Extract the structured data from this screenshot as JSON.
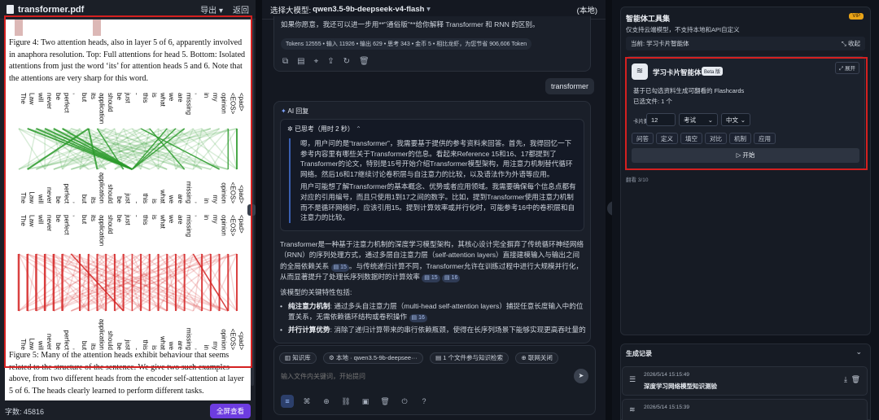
{
  "left": {
    "file_title": "transformer.pdf",
    "export_label": "导出",
    "export_arrow": "▾",
    "back_label": "返回",
    "caption4": "Figure 4: Two attention heads, also in layer 5 of 6, apparently involved in anaphora resolution. Top: Full attentions for head 5. Bottom: Isolated attentions from just the word ‘its’ for attention heads 5 and 6. Note that the attentions are very sharp for this word.",
    "caption5": "Figure 5: Many of the attention heads exhibit behaviour that seems related to the structure of the sentence. We give two such examples above, from two different heads from the encoder self-attention at layer 5 of 6. The heads clearly learned to perform different tasks.",
    "tokens": [
      "The",
      "Law",
      "will",
      "never",
      "be",
      "perfect",
      ",",
      "but",
      "its",
      "application",
      "should",
      "be",
      "just",
      "-",
      "this",
      "is",
      "what",
      "we",
      "are",
      "missing",
      ",",
      "in",
      "my",
      "opinion",
      "<EOS>",
      "<pad>"
    ],
    "word_count": "字数: 45816",
    "fullscreen_label": "全屏查看",
    "collapse_handle": "‹"
  },
  "middle": {
    "model_select_prefix": "选择大模型: ",
    "model_name": "qwen3.5-9b-deepseek-v4-flash",
    "model_arrow": "▾",
    "local_label": "(本地)",
    "intro_line": "如果你愿意，我还可以进一步用**\"通俗版\"**给你解释 Transformer 和 RNN 的区别。",
    "stats": "Tokens 12555 • 输入 11926 • 输出 629 • 思考 343 • 金币 5 • 相比龙虾，为您节省 906,606 Token",
    "user_message": "transformer",
    "ai_label": "AI 回复",
    "think_label": "已思考（用时 2 秒）",
    "think_p1": "嗯，用户问的是“transformer”，我需要基于提供的参考资料来回答。首先，我得回忆一下参考内容里有哪些关于Transformer的信息。看起来Reference 15和16、17都提到了Transformer的论文，特别是15号开始介绍Transformer模型架构，用注意力机制替代循环网络。然后16和17继续讨论卷积层与自注意力的比较，以及语法作为外语等应用。",
    "think_p2": "用户可能想了解Transformer的基本概念、优势或者应用领域。我需要确保每个信息点都有对应的引用编号，而且只使用1到17之间的数字。比如，提到Transformer使用注意力机制而不是循环网络时，应该引用15。提到计算效率或并行化时，可能参考16中的卷积层和自注意力的比较。",
    "answer_p1a": "Transformer是一种基于注意力机制的深度学习模型架构，其核心设计完全摒弃了传统循环神经网络（RNN）的序列处理方式，通过多层自注意力层（self-attention layers）直接建模输入与输出之间的全局依赖关系",
    "answer_p1b": "。与传统递归计算不同，Transformer允许在训练过程中进行大规模并行化，从而显著提升了处理长序列数据时的计算效率",
    "cite_15": "15",
    "cite_16": "16",
    "features_heading": "该模型的关键特性包括:",
    "feature1_title": "纯注意力机制",
    "feature1_text": ": 通过多头自注意力层（multi-head self-attention layers）捕捉任意长度输入中的位置关系，无需依赖循环结构或卷积操作",
    "feature2_title": "并行计算优势",
    "feature2_text": ": 消除了递归计算带来的串行依赖瓶颈，使得在长序列场景下能够实现更高吞吐量的训练",
    "pill_kb": "知识库",
    "pill_model": "本地 · qwen3.5-9b-deepsee···",
    "pill_files": "1 个文件参与知识检索",
    "pill_net": "联网关闭",
    "input_placeholder": "输入文件内关键词，开始提问",
    "send_glyph": "➤",
    "toolbar_icons": [
      "≡",
      "⌘",
      "⊕",
      "⛓",
      "▣",
      "🗑",
      "⏻",
      "?"
    ]
  },
  "right": {
    "toolbox_title": "智能体工具集",
    "vip_badge": "VIP",
    "toolbox_sub": "仅支持云端模型，不支持本地和API自定义",
    "current_label": "当前: 学习卡片智能体",
    "collapse_label": "⤡ 收起",
    "agent_name": "学习卡片智能体",
    "beta_label": "Beta 版",
    "expand_label": "⤢ 展开",
    "agent_desc": "基于已勾选资料生成可翻看的 Flashcards",
    "selected_files": "已选文件: 1 个",
    "card_count_label": "卡片数",
    "card_count_value": "12",
    "mode_value": "考试",
    "lang_value": "中文",
    "chips": [
      "问答",
      "定义",
      "填空",
      "对比",
      "机制",
      "应用"
    ],
    "start_label": "▷ 开始",
    "tail_text": "翻看 3/10",
    "records_title": "生成记录",
    "records_arrow": "⌄",
    "record1_time": "2026/5/14 15:15:49",
    "record1_title": "深度学习网络模型知识测验",
    "record2_time": "2026/5/14 15:15:39",
    "side_handle": "⊐"
  }
}
